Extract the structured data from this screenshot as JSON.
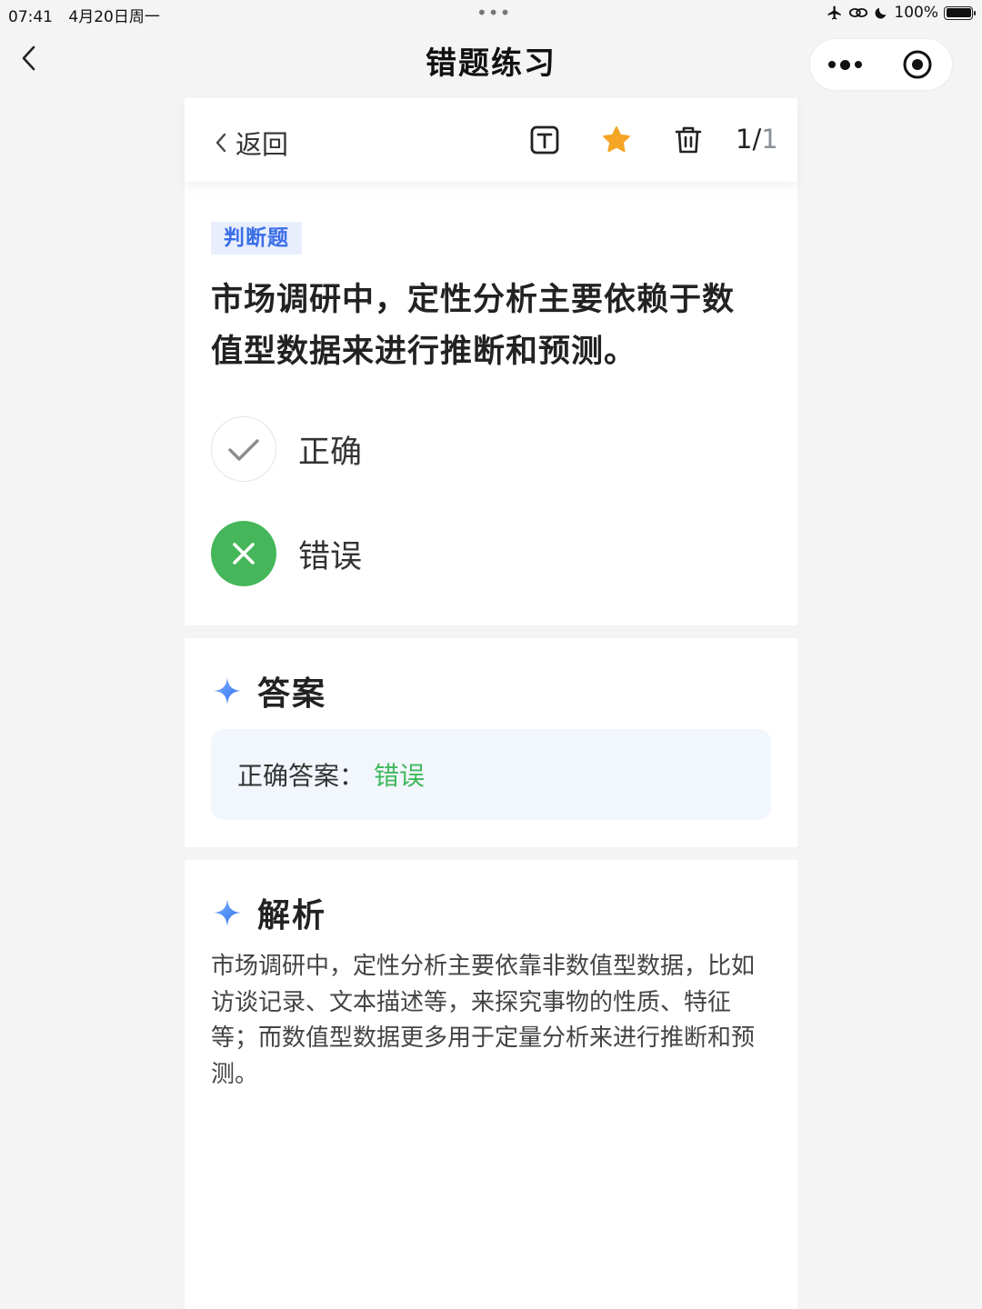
{
  "status_bar": {
    "time": "07:41",
    "date": "4月20日周一",
    "battery": "100%",
    "battery_level": 1.0
  },
  "nav": {
    "title": "错题练习"
  },
  "toolbar": {
    "back_label": "返回",
    "page_current": "1/",
    "page_total": "1",
    "icons": [
      "text-mode-icon",
      "star-icon",
      "trash-icon"
    ],
    "star_color": "#f5a524"
  },
  "question": {
    "type_tag": "判断题",
    "text": "市场调研中，定性分析主要依赖于数值型数据来进行推断和预测。",
    "options": [
      {
        "label": "正确",
        "state": "unselected"
      },
      {
        "label": "错误",
        "state": "selected-wrong"
      }
    ],
    "wrong_color": "#45b75a"
  },
  "answer": {
    "title": "答案",
    "prefix": "正确答案：",
    "value": "错误",
    "value_color": "#3fb85c"
  },
  "analysis": {
    "title": "解析",
    "text": "市场调研中，定性分析主要依靠非数值型数据，比如访谈记录、文本描述等，来探究事物的性质、特征等；而数值型数据更多用于定量分析来进行推断和预测。"
  }
}
